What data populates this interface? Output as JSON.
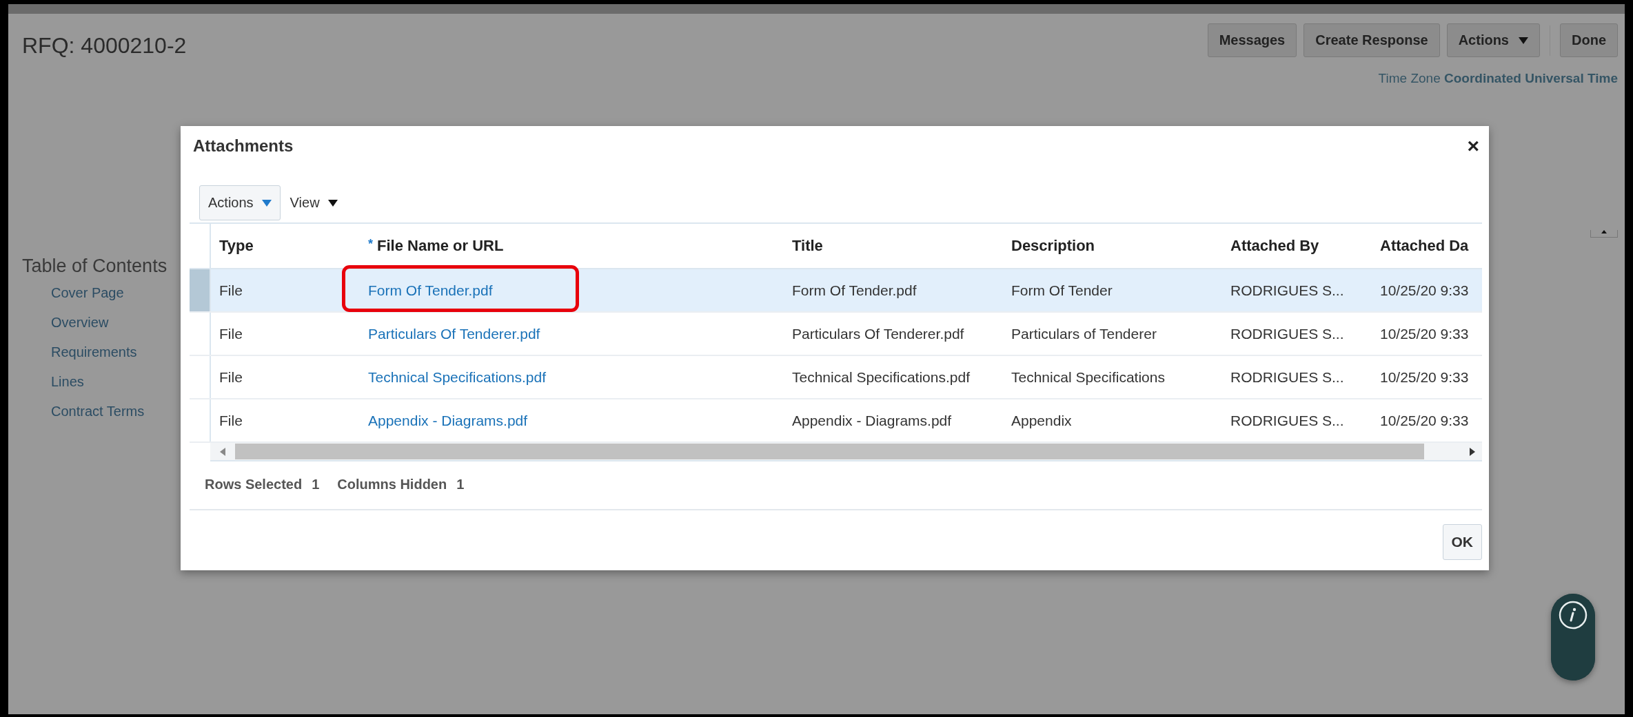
{
  "page": {
    "title": "RFQ: 4000210-2",
    "buttons": [
      {
        "label": "Messages",
        "kind": "button"
      },
      {
        "label": "Create Response",
        "kind": "button"
      },
      {
        "label": "Actions",
        "kind": "menu"
      },
      {
        "label": "Done",
        "kind": "button"
      }
    ],
    "time_zone": {
      "label": "Time Zone",
      "value": "Coordinated Universal Time"
    },
    "toc": {
      "heading": "Table of Contents",
      "items": [
        "Cover Page",
        "Overview",
        "Requirements",
        "Lines",
        "Contract Terms"
      ]
    }
  },
  "dialog": {
    "title": "Attachments",
    "close": "×",
    "toolbar": [
      {
        "label": "Actions",
        "kind": "button"
      },
      {
        "label": "View",
        "kind": "menu"
      }
    ],
    "columns": [
      {
        "label": "Type"
      },
      {
        "label": "File Name or URL",
        "required_mark": "*"
      },
      {
        "label": "Title"
      },
      {
        "label": "Description"
      },
      {
        "label": "Attached By"
      },
      {
        "label": "Attached Da"
      }
    ],
    "rows": [
      {
        "selected": true,
        "highlighted": true,
        "type": "File",
        "file_name": "Form Of Tender.pdf",
        "title": "Form Of Tender.pdf",
        "description": "Form Of Tender",
        "attached_by": "RODRIGUES S...",
        "attached_date": "10/25/20 9:33"
      },
      {
        "selected": false,
        "highlighted": false,
        "type": "File",
        "file_name": "Particulars Of Tenderer.pdf",
        "title": "Particulars Of Tenderer.pdf",
        "description": "Particulars of Tenderer",
        "attached_by": "RODRIGUES S...",
        "attached_date": "10/25/20 9:33"
      },
      {
        "selected": false,
        "highlighted": false,
        "type": "File",
        "file_name": "Technical Specifications.pdf",
        "title": "Technical Specifications.pdf",
        "description": "Technical Specifications",
        "attached_by": "RODRIGUES S...",
        "attached_date": "10/25/20 9:33"
      },
      {
        "selected": false,
        "highlighted": false,
        "type": "File",
        "file_name": "Appendix - Diagrams.pdf",
        "title": "Appendix - Diagrams.pdf",
        "description": "Appendix",
        "attached_by": "RODRIGUES S...",
        "attached_date": "10/25/20 9:33"
      }
    ],
    "status": [
      {
        "label": "Rows Selected",
        "value": "1"
      },
      {
        "label": "Columns Hidden",
        "value": "1"
      }
    ],
    "ok": "OK"
  }
}
